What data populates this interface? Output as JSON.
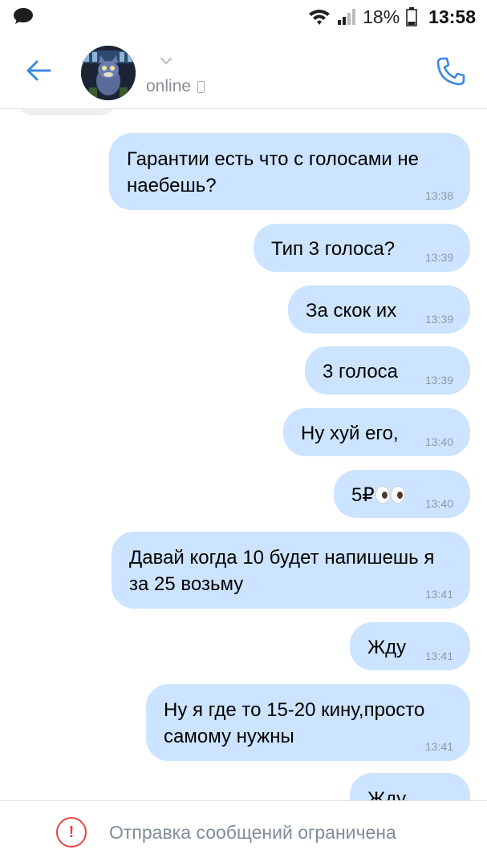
{
  "status_bar": {
    "battery_percent": "18%",
    "time": "13:58",
    "icons": [
      "chat-bubble-icon",
      "wifi-icon",
      "signal-icon",
      "battery-icon"
    ]
  },
  "header": {
    "status": "online",
    "icons": [
      "back-arrow-icon",
      "chevron-down-icon",
      "mobile-device-icon",
      "phone-call-icon"
    ]
  },
  "messages": [
    {
      "text": "Гарантии есть что с голосами не наебешь?",
      "time": "13:38"
    },
    {
      "text": "Тип 3 голоса?",
      "time": "13:39"
    },
    {
      "text": "За скок их",
      "time": "13:39"
    },
    {
      "text": "3 голоса",
      "time": "13:39"
    },
    {
      "text": "Ну хуй его,",
      "time": "13:40"
    },
    {
      "text": "5₽",
      "emoji": "eyes",
      "time": "13:40"
    },
    {
      "text": "Давай когда 10 будет напишешь я за 25 возьму",
      "time": "13:41"
    },
    {
      "text": "Жду",
      "time": "13:41"
    },
    {
      "text": "Ну я где то 15-20 кину,просто самому нужны",
      "time": "13:41"
    },
    {
      "text": "Жду",
      "time": ""
    }
  ],
  "restriction": {
    "text": "Отправка сообщений ограничена",
    "icon": "exclamation-circle-icon"
  },
  "colors": {
    "accent": "#3f8ae0",
    "bubble": "#cce4ff",
    "timestamp": "#8d9aa8",
    "muted_text": "#818c99",
    "warning": "#e64646"
  }
}
